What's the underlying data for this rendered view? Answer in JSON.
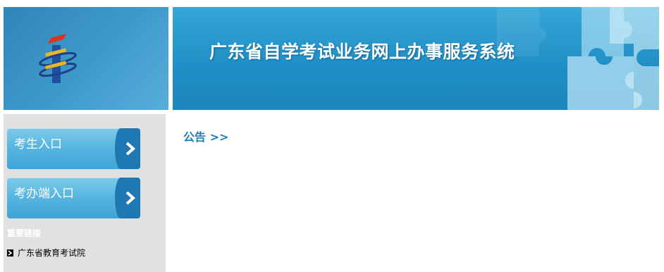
{
  "header": {
    "title": "广东省自学考试业务网上办事服务系统"
  },
  "sidebar": {
    "entries": [
      {
        "label": "考生入口"
      },
      {
        "label": "考办端入口"
      }
    ],
    "links_title": "重要链接",
    "links": [
      {
        "label": "广东省教育考试院"
      }
    ]
  },
  "main": {
    "notice_heading": "公告 >>"
  },
  "colors": {
    "banner": "#2196ca",
    "accent_text": "#1a7fb9",
    "sidebar_bg": "#e1e1e1",
    "button": "#58b6e0",
    "arrow": "#1e78b4"
  }
}
